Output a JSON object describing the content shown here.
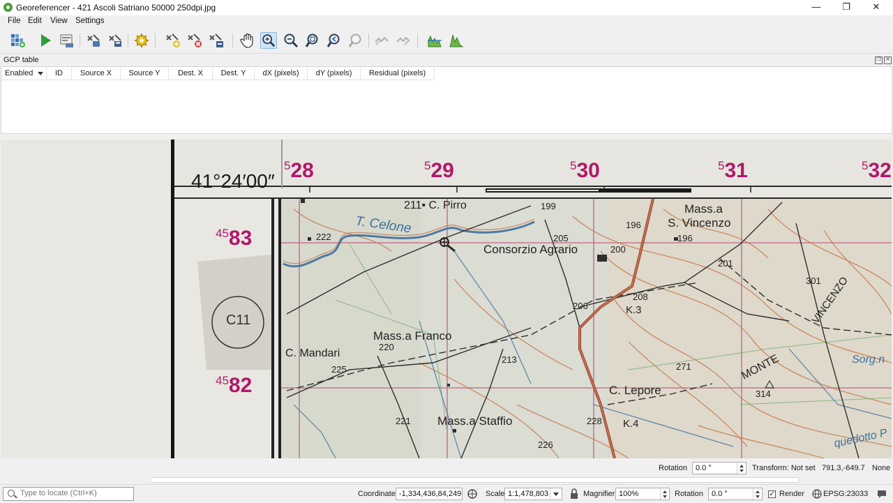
{
  "window": {
    "title": "Georeferencer - 421 Ascoli Satriano 50000 250dpi.jpg",
    "minimize": "—",
    "maximize": "❐",
    "close": "✕"
  },
  "menu": [
    {
      "label": "File"
    },
    {
      "label": "Edit"
    },
    {
      "label": "View"
    },
    {
      "label": "Settings"
    }
  ],
  "gcp_panel": {
    "title": "GCP table",
    "columns": [
      "Enabled",
      "ID",
      "Source X",
      "Source Y",
      "Dest. X",
      "Dest. Y",
      "dX (pixels)",
      "dY (pixels)",
      "Residual (pixels)"
    ]
  },
  "map": {
    "lat_label": "41°24′00″",
    "easting": [
      {
        "sup": "5",
        "num": "28"
      },
      {
        "sup": "5",
        "num": "29"
      },
      {
        "sup": "5",
        "num": "30"
      },
      {
        "sup": "5",
        "num": "31"
      },
      {
        "sup": "5",
        "num": "32"
      }
    ],
    "northing": [
      {
        "sup": "45",
        "num": "83"
      },
      {
        "sup": "45",
        "num": "82"
      }
    ],
    "places": {
      "c_pirro": "211• C. Pirro",
      "celone": "T. Celone",
      "mass_vincenzo": "Mass.a",
      "s_vincenzo": "S. Vincenzo",
      "consorzio": "Consorzio Agrario",
      "mass_franco": "Mass.a Franco",
      "c_mandari": "C. Mandari",
      "c_lepore": "C. Lepore",
      "mass_staffio": "Mass.a Staffio",
      "monte": "MONTE",
      "vincenzo": "VINCENZO",
      "sorg": "Sorg.n",
      "acquedotto": "quedotto P",
      "k3": "K.3",
      "k4": "K.4"
    },
    "spot_heights": [
      "199",
      "196",
      "196",
      "205",
      "200",
      "222",
      "201",
      "301",
      "206",
      "208",
      "220",
      "225",
      "213",
      "271",
      "314",
      "221",
      "228",
      "226"
    ],
    "stamp": "C11"
  },
  "status_top": {
    "rotation_label": "Rotation",
    "rotation_value": "0.0 °",
    "transform": "Transform: Not set",
    "coords": "791.3,-649.7",
    "crs": "None"
  },
  "status_bottom": {
    "locator_placeholder": "Type to locate (Ctrl+K)",
    "coordinate_label": "Coordinate",
    "coordinate_value": "-1,334,436,84,249",
    "scale_label": "Scale",
    "scale_value": "1:1,478,803",
    "magnifier_label": "Magnifier",
    "magnifier_value": "100%",
    "rotation_label": "Rotation",
    "rotation_value": "0.0 °",
    "render_label": "Render",
    "epsg": "EPSG:23033"
  },
  "colors": {
    "map_red_text": "#b0186a",
    "grid_magenta": "#b0386e",
    "contour": "#c0683a",
    "river": "#3d6f9c"
  }
}
